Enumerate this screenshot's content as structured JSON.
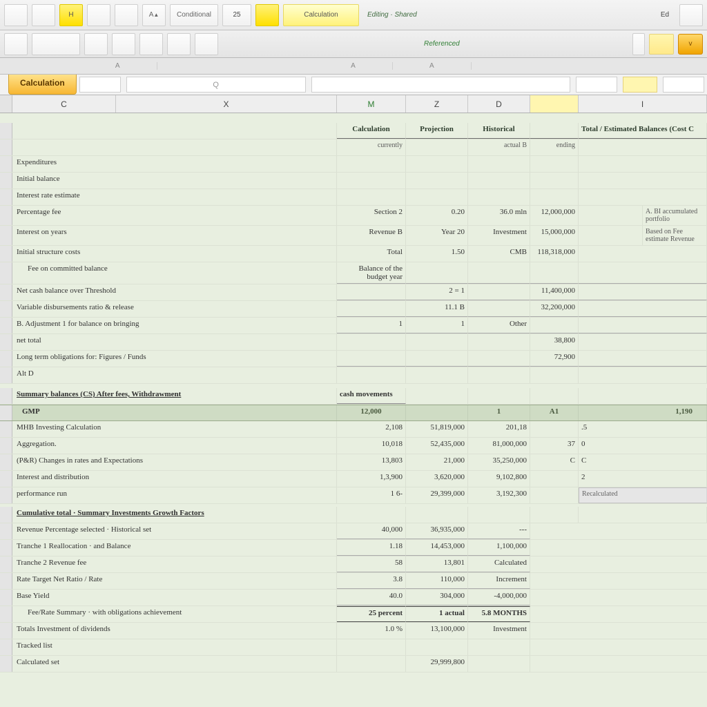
{
  "ribbon1": {
    "btns": [
      "",
      "",
      "H"
    ],
    "num": "25",
    "wide1": "Conditional",
    "yellowL": "Calculation",
    "status": "Editing · Shared",
    "right": "Ed"
  },
  "ribbon2": {
    "btns": [
      "",
      "",
      "",
      "",
      "",
      ""
    ],
    "greenlbl": "Referenced",
    "orangebtn": "v"
  },
  "ministrip": [
    "",
    "A",
    "",
    "",
    "A",
    "A",
    "",
    "",
    ""
  ],
  "sheettab": "Calculation",
  "fxq": "Q",
  "fxr1": "",
  "fxr2": "",
  "colhdr": {
    "c": "C",
    "x": "X",
    "m": "M",
    "z": "Z",
    "d": "D",
    "i": "I"
  },
  "block1": {
    "header": {
      "a": "Calculation",
      "b": "Projection",
      "c": "Historical",
      "d": "Total / Estimated Balances (Cost C"
    },
    "sub": {
      "a": "currently",
      "b": "",
      "c": "actual B",
      "d": "ending"
    },
    "note1": "A. BI accumulated portfolio",
    "note2": "Based on Fee estimate Revenue",
    "rows": [
      {
        "desc": "Expenditures",
        "a": "",
        "b": "",
        "c": "",
        "d": ""
      },
      {
        "desc": "Initial balance",
        "a": "",
        "b": "",
        "c": "",
        "d": ""
      },
      {
        "desc": "Interest rate estimate",
        "a": "",
        "b": "",
        "c": "",
        "d": ""
      },
      {
        "desc": "Percentage fee",
        "a": "Section 2",
        "b": "0.20",
        "c": "36.0 mln",
        "d": "12,000,000"
      },
      {
        "desc": "Interest on years",
        "a": "Revenue B",
        "b": "Year 20",
        "c": "Investment",
        "d": "15,000,000"
      },
      {
        "desc": "Initial structure costs",
        "a": "Total",
        "b": "1.50",
        "c": "CMB",
        "d": "118,318,000"
      },
      {
        "desc": "Fee on committed balance",
        "a": "Balance of the budget year",
        "b": "",
        "c": "",
        "d": "",
        "indent": true,
        "thin": true
      },
      {
        "desc": "Net cash balance over Threshold",
        "a": "",
        "b": "2 = 1",
        "c": "",
        "d": "11,400,000",
        "thin": true
      },
      {
        "desc": "Variable disbursements ratio & release",
        "a": "",
        "b": "11.1 B",
        "c": "",
        "d": "32,200,000",
        "thin": true
      },
      {
        "desc": "B. Adjustment 1 for balance on bringing",
        "a": "1",
        "b": "1",
        "c": "Other",
        "d": "",
        "thin": true
      },
      {
        "desc": "net total",
        "a": "",
        "b": "",
        "c": "",
        "d": "38,800"
      },
      {
        "desc": "Long term obligations for: Figures / Funds",
        "a": "",
        "b": "",
        "c": "",
        "d": "72,900",
        "thin": true
      },
      {
        "desc": "Alt D",
        "a": "",
        "b": "",
        "c": "",
        "d": ""
      }
    ]
  },
  "block2": {
    "title": "Summary balances (CS) After fees, Withdrawment",
    "subhead": "cash movements",
    "cats": [
      "GMP",
      "12,000",
      "",
      "1",
      "A1",
      "1,190"
    ],
    "rows": [
      {
        "desc": "MHB Investing Calculation",
        "a": "2,108",
        "b": "51,819,000",
        "c": "201,18",
        "d": "",
        "e": ".5"
      },
      {
        "desc": "Aggregation.",
        "a": "10,018",
        "b": "52,435,000",
        "c": "81,000,000",
        "d": "37",
        "e": "0"
      },
      {
        "desc": "(P&R) Changes in rates and Expectations",
        "a": "13,803",
        "b": "21,000",
        "c": "35,250,000",
        "d": "C",
        "e": "C"
      },
      {
        "desc": "Interest and distribution",
        "a": "1,3,900",
        "b": "3,620,000",
        "c": "9,102,800",
        "d": "",
        "e": "2"
      },
      {
        "desc": "performance run",
        "a": "1   6-",
        "b": "29,399,000",
        "c": "3,192,300",
        "d": "",
        "e": "Recalculated",
        "grey": true
      }
    ]
  },
  "block3": {
    "title": "Cumulative total · Summary Investments Growth Factors",
    "rows": [
      {
        "desc": "Revenue Percentage selected · Historical set",
        "a": "40,000",
        "b": "36,935,000",
        "c": "---",
        "thin": true
      },
      {
        "desc": "Tranche 1  Reallocation · and Balance",
        "a": "1.18",
        "b": "14,453,000",
        "c": "1,100,000",
        "thin": true
      },
      {
        "desc": "Tranche 2  Revenue fee",
        "a": "58",
        "b": "13,801",
        "c": "Calculated",
        "thin": true
      },
      {
        "desc": "Rate Target Net Ratio / Rate",
        "a": "3.8",
        "b": "110,000",
        "c": "Increment",
        "thin": true
      },
      {
        "desc": "Base Yield",
        "a": "40.0",
        "b": "304,000",
        "c": "-4,000,000",
        "thin": true
      },
      {
        "desc": "Fee/Rate  Summary ·  with obligations achievement",
        "a": "25 percent",
        "b": "1 actual",
        "c": "5.8 MONTHS",
        "indent": true,
        "total": true
      },
      {
        "desc": "Totals  Investment of  dividends",
        "a": "1.0 %",
        "b": "13,100,000",
        "c": "Investment"
      },
      {
        "desc": "Tracked list",
        "a": "",
        "b": "",
        "c": ""
      },
      {
        "desc": "Calculated set",
        "a": "",
        "b": "29,999,800",
        "c": ""
      }
    ]
  }
}
